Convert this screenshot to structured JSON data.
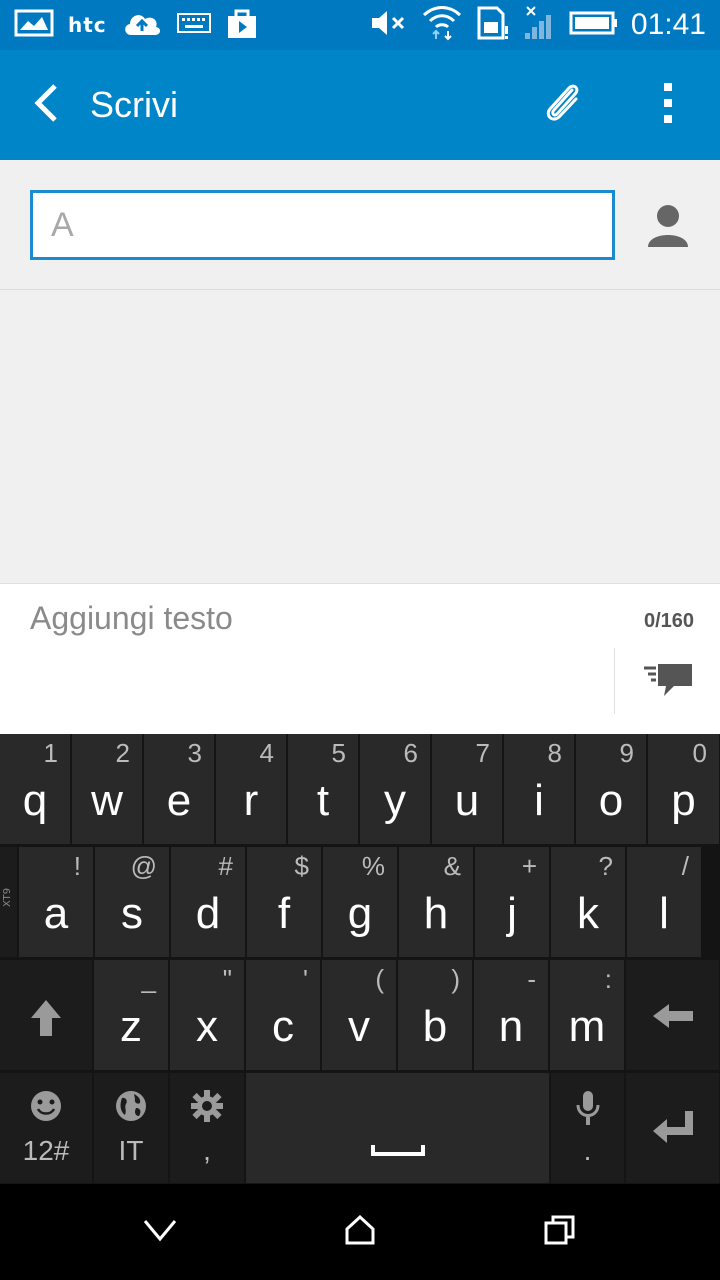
{
  "status_bar": {
    "carrier_text": "htc",
    "time": "01:41"
  },
  "app_bar": {
    "title": "Scrivi"
  },
  "recipient": {
    "placeholder": "A"
  },
  "compose": {
    "placeholder": "Aggiungi testo",
    "char_count": "0/160"
  },
  "keyboard": {
    "row1": [
      {
        "key": "q",
        "hint": "1"
      },
      {
        "key": "w",
        "hint": "2"
      },
      {
        "key": "e",
        "hint": "3"
      },
      {
        "key": "r",
        "hint": "4"
      },
      {
        "key": "t",
        "hint": "5"
      },
      {
        "key": "y",
        "hint": "6"
      },
      {
        "key": "u",
        "hint": "7"
      },
      {
        "key": "i",
        "hint": "8"
      },
      {
        "key": "o",
        "hint": "9"
      },
      {
        "key": "p",
        "hint": "0"
      }
    ],
    "row2": [
      {
        "key": "a",
        "hint": "!"
      },
      {
        "key": "s",
        "hint": "@"
      },
      {
        "key": "d",
        "hint": "#"
      },
      {
        "key": "f",
        "hint": "$"
      },
      {
        "key": "g",
        "hint": "%"
      },
      {
        "key": "h",
        "hint": "&"
      },
      {
        "key": "j",
        "hint": "+"
      },
      {
        "key": "k",
        "hint": "?"
      },
      {
        "key": "l",
        "hint": "/"
      }
    ],
    "row3": [
      {
        "key": "z",
        "hint": "_"
      },
      {
        "key": "x",
        "hint": "\""
      },
      {
        "key": "c",
        "hint": "'"
      },
      {
        "key": "v",
        "hint": "("
      },
      {
        "key": "b",
        "hint": ")"
      },
      {
        "key": "n",
        "hint": "-"
      },
      {
        "key": "m",
        "hint": ":"
      }
    ],
    "xt9_label": "XT9",
    "symbols_label": "12#",
    "language_label": "IT",
    "settings_sub": ",",
    "mic_sub": "."
  },
  "colors": {
    "status_bar": "#0079c1",
    "app_bar": "#0085c8",
    "field_border": "#1a8ad1",
    "keyboard_bg": "#141414",
    "key_bg": "#292929"
  }
}
